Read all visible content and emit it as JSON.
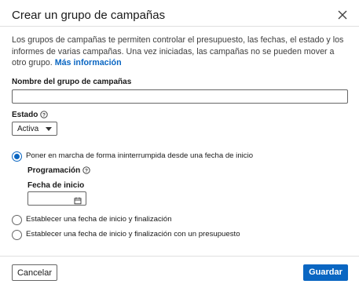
{
  "modal": {
    "title": "Crear un grupo de campañas",
    "close_icon": "close-icon",
    "description": "Los grupos de campañas te permiten controlar el presupuesto, las fechas, el estado y los informes de varias campañas. Una vez iniciadas, las campañas no se pueden mover a otro grupo.",
    "more_info_link": "Más información"
  },
  "form": {
    "name_label": "Nombre del grupo de campañas",
    "name_value": "",
    "status_label": "Estado",
    "status_value": "Activa",
    "status_help_icon": "help-circle-icon",
    "schedule_options": [
      {
        "label": "Poner en marcha de forma ininterrumpida desde una fecha de inicio",
        "checked": true
      },
      {
        "label": "Establecer una fecha de inicio y finalización",
        "checked": false
      },
      {
        "label": "Establecer una fecha de inicio y finalización con un presupuesto",
        "checked": false
      }
    ],
    "programming_label": "Programación",
    "start_date_label": "Fecha de inicio",
    "start_date_value": "",
    "calendar_icon": "calendar-icon"
  },
  "footer": {
    "cancel_label": "Cancelar",
    "save_label": "Guardar"
  },
  "colors": {
    "accent": "#0a66c2",
    "border": "#666666",
    "divider": "#e0e0e0"
  }
}
